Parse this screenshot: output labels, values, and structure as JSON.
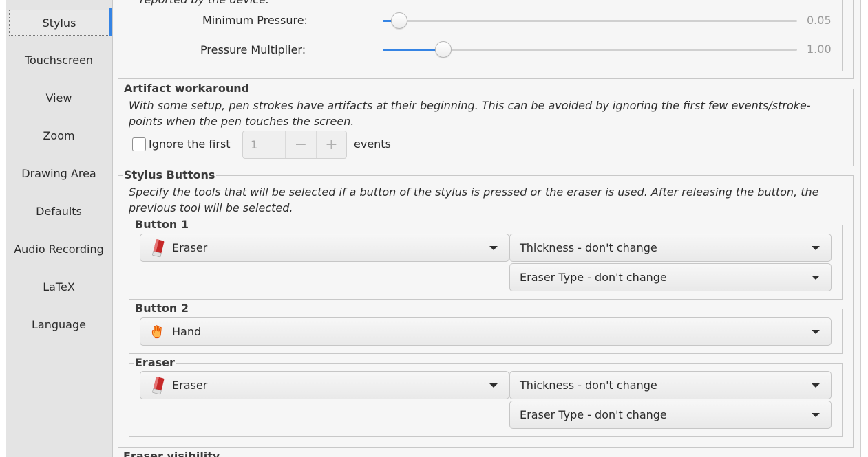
{
  "sidebar": {
    "items": [
      {
        "label": "Stylus",
        "active": true
      },
      {
        "label": "Touchscreen"
      },
      {
        "label": "View"
      },
      {
        "label": "Zoom"
      },
      {
        "label": "Drawing Area"
      },
      {
        "label": "Defaults"
      },
      {
        "label": "Audio Recording"
      },
      {
        "label": "LaTeX"
      },
      {
        "label": "Language"
      }
    ]
  },
  "pressure": {
    "cut_text": "reported by the device.",
    "minimum": {
      "label": "Minimum Pressure:",
      "value_text": "0.05",
      "fraction": 0.04
    },
    "multiplier": {
      "label": "Pressure Multiplier:",
      "value_text": "1.00",
      "fraction": 0.147
    }
  },
  "artifact": {
    "title": "Artifact workaround",
    "description": "With some setup, pen strokes have artifacts at their beginning. This can be avoided by ignoring the first few events/stroke-points when the pen touches the screen.",
    "checkbox_label": "Ignore the first",
    "checked": false,
    "spin_value": "1",
    "minus": "−",
    "plus": "+",
    "suffix": "events"
  },
  "stylus_buttons": {
    "title": "Stylus Buttons",
    "description": "Specify the tools that will be selected if a button of the stylus is pressed or the eraser is used. After releasing the button, the previous tool will be selected.",
    "button1": {
      "title": "Button 1",
      "tool": "Eraser",
      "tool_icon": "eraser-icon",
      "thickness": "Thickness - don't change",
      "eraser_type": "Eraser Type - don't change"
    },
    "button2": {
      "title": "Button 2",
      "tool": "Hand",
      "tool_icon": "hand-icon"
    },
    "eraser": {
      "title": "Eraser",
      "tool": "Eraser",
      "tool_icon": "eraser-icon",
      "thickness": "Thickness - don't change",
      "eraser_type": "Eraser Type - don't change"
    }
  },
  "next_section_title": "Eraser visibility",
  "colors": {
    "accent": "#3584e4",
    "eraser_red": "#c62828",
    "hand_orange": "#f57c00"
  }
}
